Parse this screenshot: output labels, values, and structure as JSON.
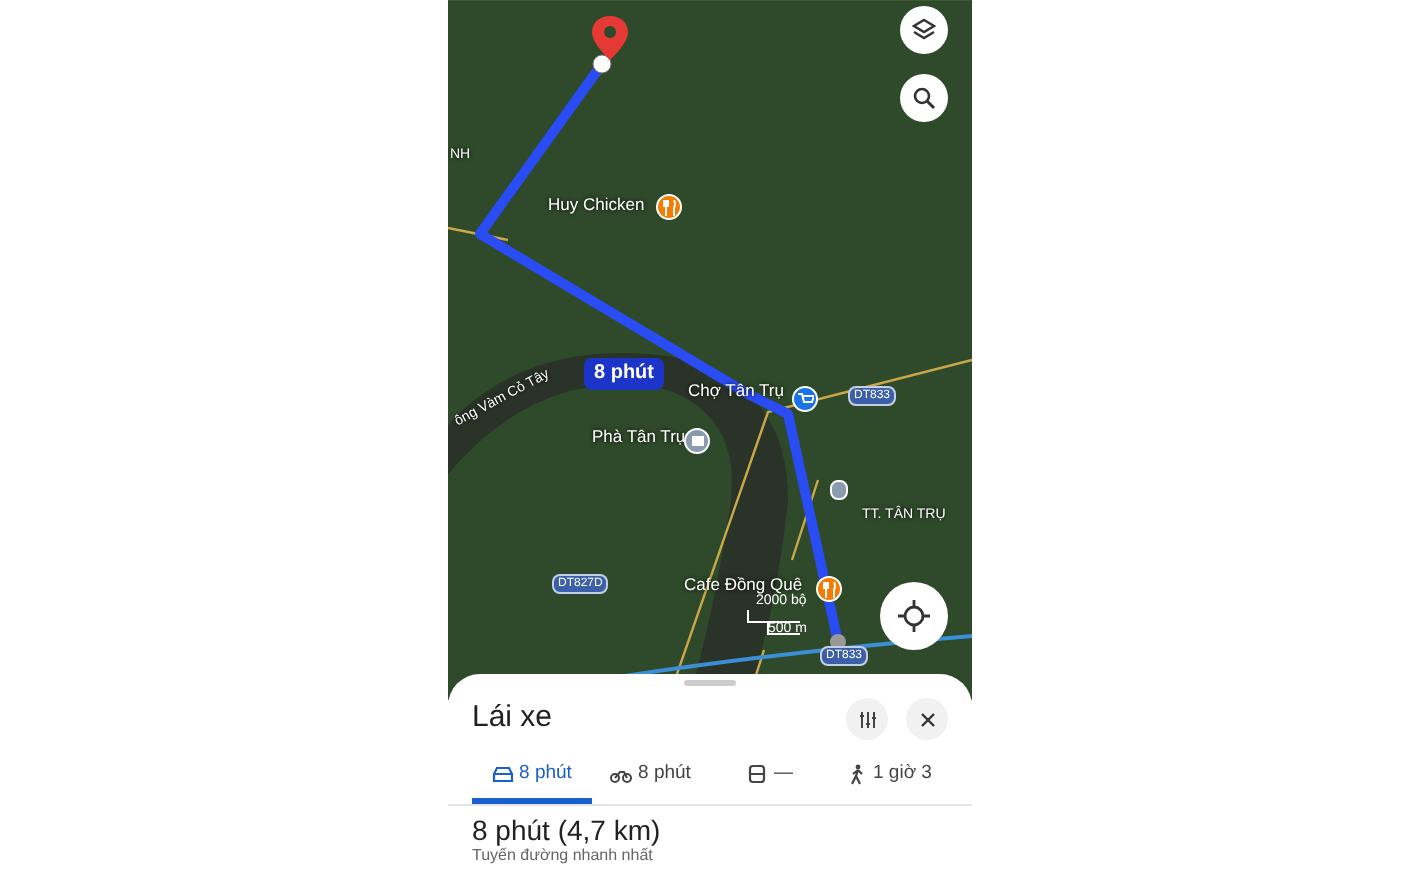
{
  "map": {
    "labels": [
      {
        "kind": "area",
        "text": "NH"
      },
      {
        "kind": "food",
        "text": "Huy Chicken"
      },
      {
        "kind": "badge",
        "text": "8 phút"
      },
      {
        "kind": "road",
        "text": "DT833"
      },
      {
        "kind": "shop",
        "text": "Chợ Tân Trụ"
      },
      {
        "kind": "area",
        "text": "ông Vàm Cỏ Tây"
      },
      {
        "kind": "ferry",
        "text": "Phà Tân Trụ"
      },
      {
        "kind": "area",
        "text": "TT. TÂN TRỤ"
      },
      {
        "kind": "road",
        "text": "DT827D"
      },
      {
        "kind": "food",
        "text": "Cafe Đồng Quê"
      },
      {
        "kind": "scale",
        "text": "2000 bộ"
      },
      {
        "kind": "scale",
        "text": "500 m"
      },
      {
        "kind": "road",
        "text": "DT833"
      }
    ]
  },
  "sheet": {
    "title": "Lái xe",
    "tabs": [
      {
        "kind": "car",
        "label": "8 phút",
        "selected": true
      },
      {
        "kind": "motorbike",
        "label": "8 phút",
        "selected": false
      },
      {
        "kind": "transit",
        "label": "—",
        "selected": false
      },
      {
        "kind": "walk",
        "label": "1 giờ 3",
        "selected": false
      }
    ],
    "summary": "8 phút (4,7 km)",
    "subtitle": "Tuyến đường nhanh nhất"
  }
}
